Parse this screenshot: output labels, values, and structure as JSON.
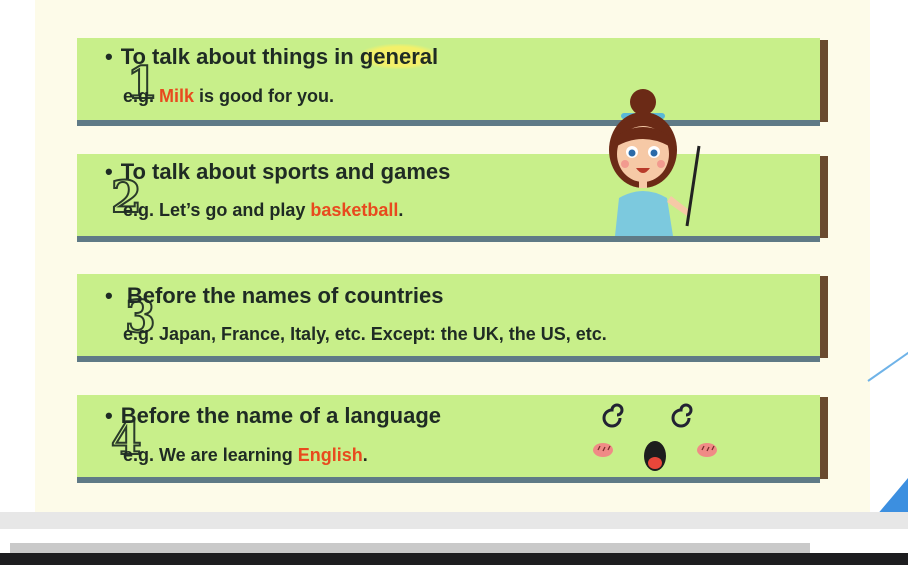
{
  "cards": [
    {
      "number": "1",
      "bullet_pre": "To talk about things in ",
      "bullet_hl": "general",
      "example_pre": "e.g. ",
      "example_hl": "Milk",
      "example_post": " is good for you."
    },
    {
      "number": "2",
      "bullet": "To talk about sports and games",
      "example_pre": "e.g. Let’s go and play ",
      "example_hl": "basketball",
      "example_post": "."
    },
    {
      "number": "3",
      "bullet": " Before the names of countries",
      "example": "e.g. Japan, France, Italy, etc. Except: the UK, the US, etc."
    },
    {
      "number": "4",
      "bullet": "Before the name of a language",
      "example_pre": "e.g. We are learning ",
      "example_hl": "English",
      "example_post": "."
    }
  ],
  "colors": {
    "card": "#c8ef8a",
    "highlight_text": "#e84a1e",
    "general_marker": "#f3f06a"
  },
  "icons": [
    "teacher-illustration",
    "dizzy-face-icon"
  ]
}
